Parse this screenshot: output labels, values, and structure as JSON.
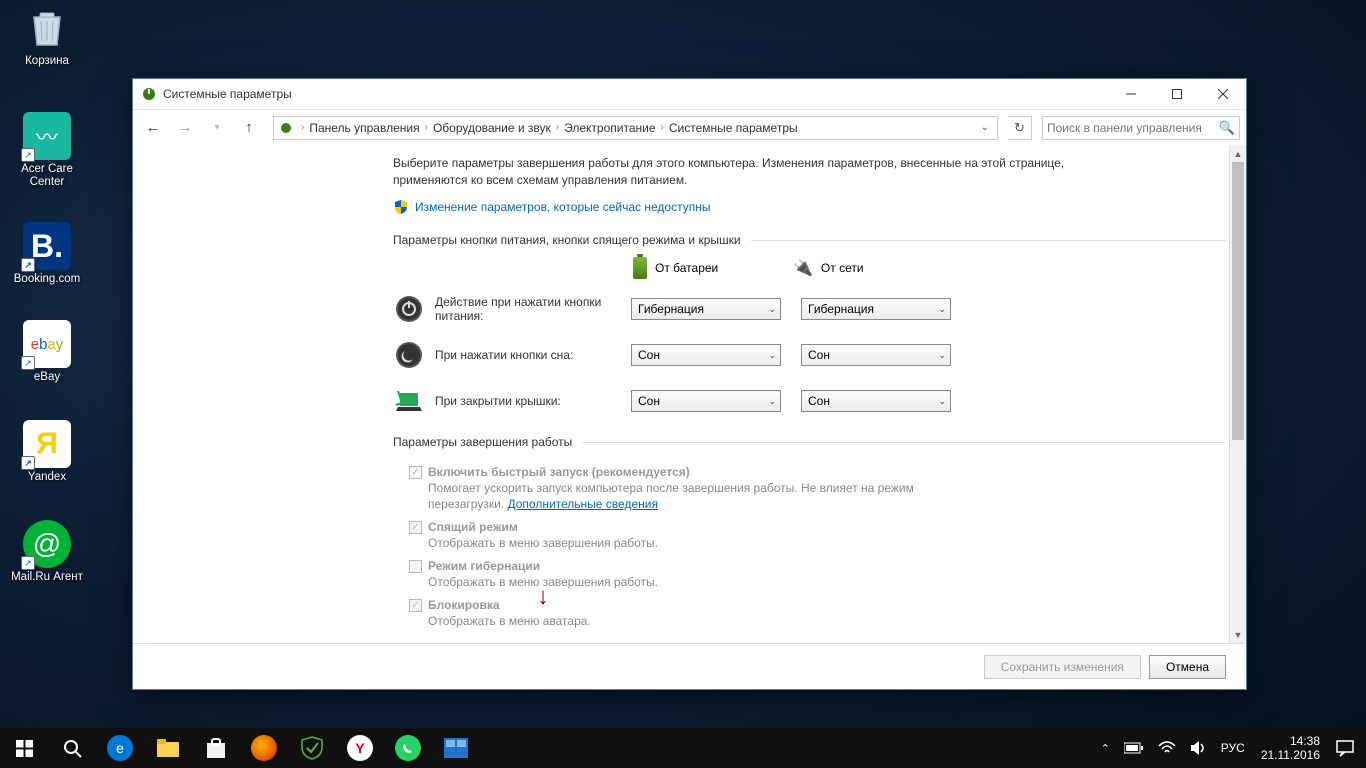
{
  "desktop_icons": {
    "recycle": "Корзина",
    "acer": "Acer Care Center",
    "booking": "Booking.com",
    "ebay": "eBay",
    "yandex": "Yandex",
    "mailru": "Mail.Ru Агент"
  },
  "window": {
    "title": "Системные параметры",
    "breadcrumb": [
      "Панель управления",
      "Оборудование и звук",
      "Электропитание",
      "Системные параметры"
    ],
    "search_placeholder": "Поиск в панели управления",
    "intro": "Выберите параметры завершения работы для этого компьютера. Изменения параметров, внесенные на этой странице, применяются ко всем схемам управления питанием.",
    "shield_link": "Изменение параметров, которые сейчас недоступны",
    "section1": "Параметры кнопки питания, кнопки спящего режима и крышки",
    "col_battery": "От батареи",
    "col_plugged": "От сети",
    "rows": {
      "power": {
        "label": "Действие при нажатии кнопки питания:",
        "battery": "Гибернация",
        "plugged": "Гибернация"
      },
      "sleep": {
        "label": "При нажатии кнопки сна:",
        "battery": "Сон",
        "plugged": "Сон"
      },
      "lid": {
        "label": "При закрытии крышки:",
        "battery": "Сон",
        "plugged": "Сон"
      }
    },
    "section2": "Параметры завершения работы",
    "opts": {
      "fast": {
        "label": "Включить быстрый запуск (рекомендуется)",
        "desc_1": "Помогает ускорить запуск компьютера после завершения работы. Не влияет на режим перезагрузки. ",
        "link": "Дополнительные сведения"
      },
      "sleep": {
        "label": "Спящий режим",
        "desc": "Отображать в меню завершения работы."
      },
      "hiber": {
        "label": "Режим гибернации",
        "desc": "Отображать в меню завершения работы."
      },
      "lock": {
        "label": "Блокировка",
        "desc": "Отображать в меню аватара."
      }
    },
    "btn_save": "Сохранить изменения",
    "btn_cancel": "Отмена"
  },
  "taskbar": {
    "lang": "РУС",
    "time": "14:38",
    "date": "21.11.2016"
  }
}
